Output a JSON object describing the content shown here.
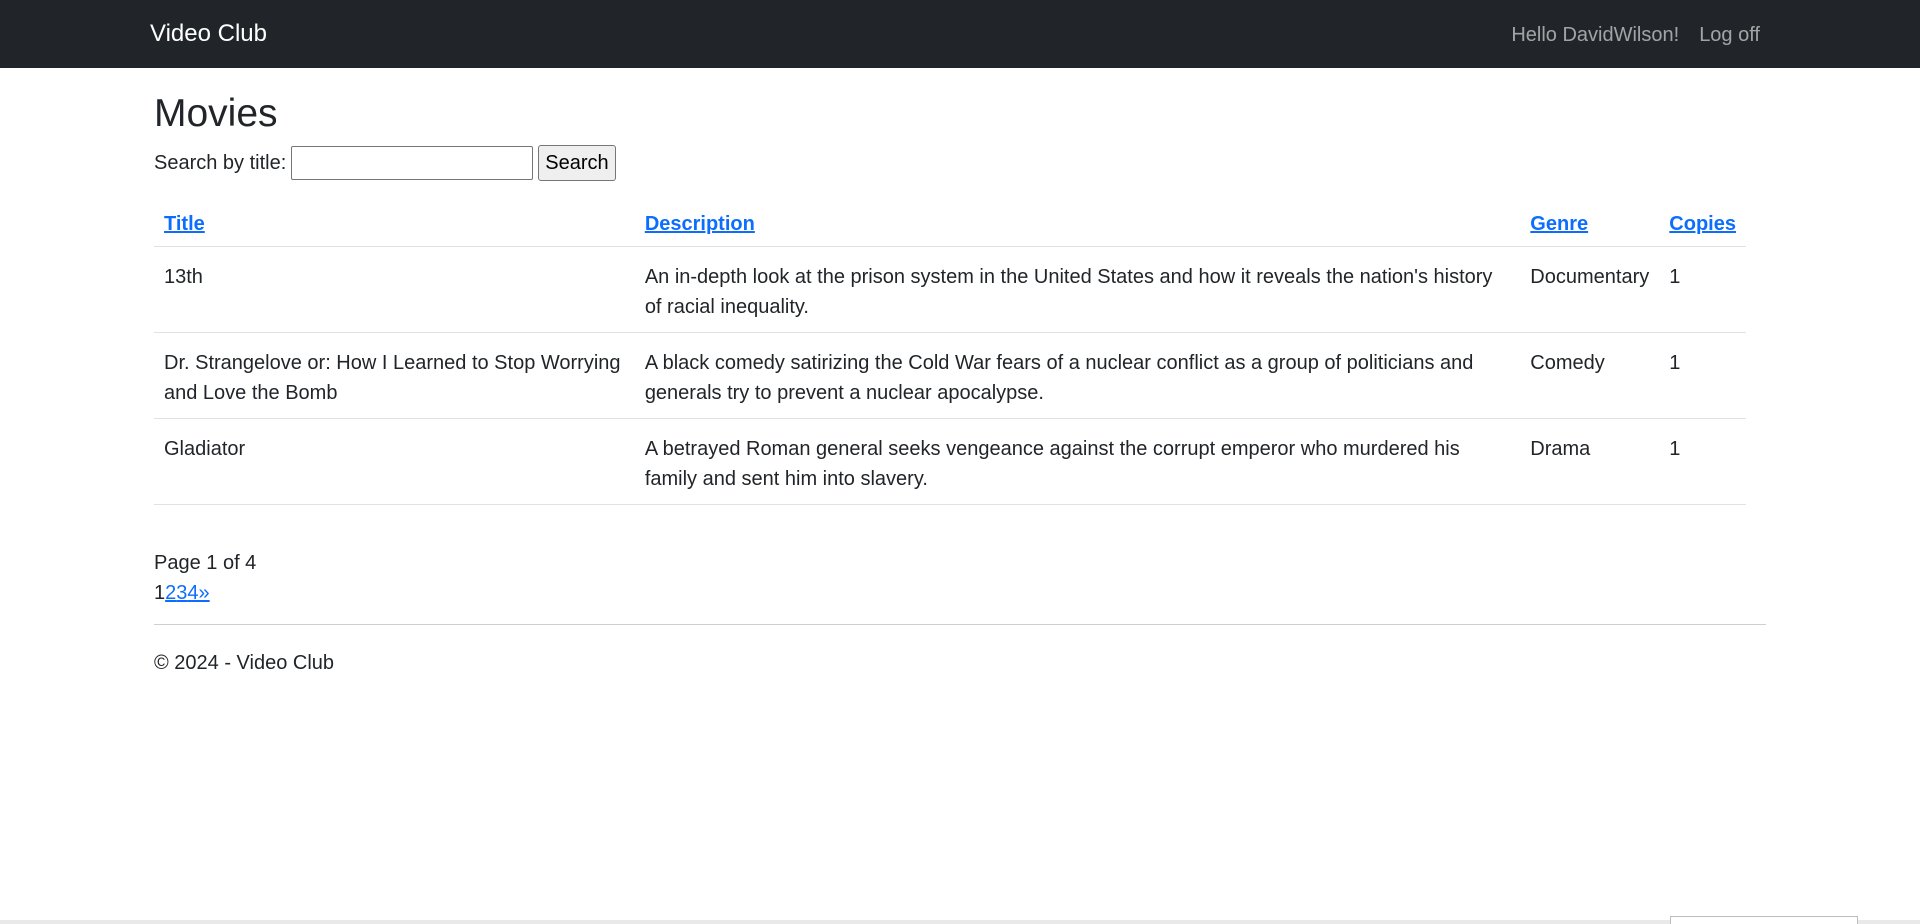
{
  "navbar": {
    "brand": "Video Club",
    "greeting": "Hello DavidWilson!",
    "logoff": "Log off",
    "bg_color": "#212529"
  },
  "page": {
    "title": "Movies"
  },
  "search": {
    "label": "Search by title:",
    "value": "",
    "button": "Search"
  },
  "table": {
    "headers": {
      "title": "Title",
      "description": "Description",
      "genre": "Genre",
      "copies": "Copies"
    },
    "rows": [
      {
        "title": "13th",
        "description": "An in-depth look at the prison system in the United States and how it reveals the nation's history of racial inequality.",
        "genre": "Documentary",
        "copies": "1"
      },
      {
        "title": "Dr. Strangelove or: How I Learned to Stop Worrying and Love the Bomb",
        "description": "A black comedy satirizing the Cold War fears of a nuclear conflict as a group of politicians and generals try to prevent a nuclear apocalypse.",
        "genre": "Comedy",
        "copies": "1"
      },
      {
        "title": "Gladiator",
        "description": "A betrayed Roman general seeks vengeance against the corrupt emperor who murdered his family and sent him into slavery.",
        "genre": "Drama",
        "copies": "1"
      }
    ]
  },
  "pager": {
    "info": "Page 1 of 4",
    "current": "1",
    "links": [
      "2",
      "3",
      "4",
      "»"
    ]
  },
  "footer": {
    "text": "© 2024 - Video Club"
  },
  "colors": {
    "link": "#0d6efd",
    "text": "#212529",
    "border": "#dee2e6"
  }
}
